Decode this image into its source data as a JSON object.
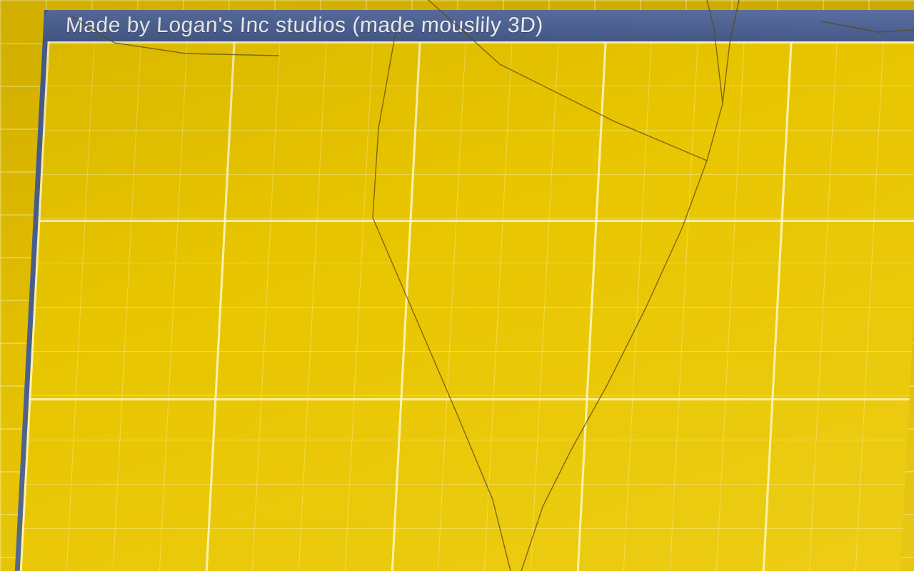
{
  "window": {
    "title": "Made by Logan's Inc studios (made mouslily 3D)"
  },
  "colors": {
    "background": "#e2bd00",
    "canvas": "#e8c500",
    "grid_line": "#fff8c8",
    "titlebar": "#4a5f8f",
    "title_text": "#f2f2f2"
  }
}
